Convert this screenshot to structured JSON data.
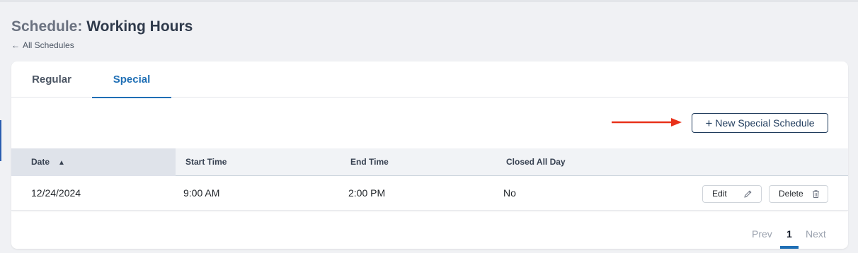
{
  "header": {
    "title_prefix": "Schedule:",
    "title_name": "Working Hours",
    "back_label": "All Schedules"
  },
  "tabs": [
    {
      "label": "Regular",
      "active": false
    },
    {
      "label": "Special",
      "active": true
    }
  ],
  "toolbar": {
    "new_label": "New Special Schedule"
  },
  "table": {
    "columns": [
      "Date",
      "Start Time",
      "End Time",
      "Closed All Day"
    ],
    "sort": {
      "column": "Date",
      "direction": "asc"
    },
    "rows": [
      {
        "date": "12/24/2024",
        "start": "9:00 AM",
        "end": "2:00 PM",
        "closed": "No",
        "edit_label": "Edit",
        "delete_label": "Delete"
      }
    ]
  },
  "pagination": {
    "prev_label": "Prev",
    "current_page": "1",
    "next_label": "Next"
  },
  "colors": {
    "accent": "#1f6fb5",
    "primary_button": "#1f3b5c",
    "annotation_arrow": "#e8311a"
  },
  "icons": {
    "back": "arrow-left-icon",
    "new": "plus-icon",
    "sort": "sort-asc-icon",
    "edit": "pencil-icon",
    "delete": "trash-icon",
    "annotation": "red-arrow-icon"
  }
}
